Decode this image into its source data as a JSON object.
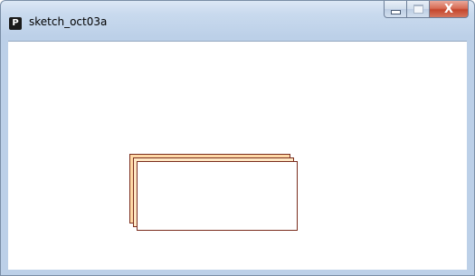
{
  "window": {
    "app_icon_glyph": "P",
    "title": "sketch_oct03a",
    "controls": {
      "minimize_icon": "minimize-icon",
      "maximize_icon": "maximize-icon",
      "close_glyph": "X"
    }
  },
  "colors": {
    "shape_stroke": "#7a2d1d",
    "back_fill": "#ffd9a6",
    "front_fill": "#ffffff",
    "canvas_background": "#ffffff"
  }
}
